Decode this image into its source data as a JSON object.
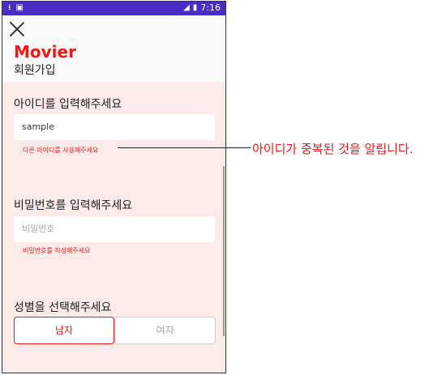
{
  "status_bar": {
    "time": "7:16",
    "left_icons": [
      "download-icon",
      "a-notification-icon"
    ],
    "right_icons": [
      "signal-icon",
      "battery-icon"
    ]
  },
  "header": {
    "brand": "Movier",
    "title": "회원가입"
  },
  "id_section": {
    "label": "아이디를 입력해주세요",
    "value": "sample",
    "error": "다른 아이디를 사용해주세요"
  },
  "password_section": {
    "label": "비밀번호를 입력해주세요",
    "placeholder": "비밀번호",
    "error": "비밀번호를 작성해주세요"
  },
  "gender_section": {
    "label": "성별을 선택해주세요",
    "options": [
      {
        "label": "남자",
        "selected": true
      },
      {
        "label": "여자",
        "selected": false
      }
    ]
  },
  "annotation": {
    "text": "아이디가 중복된 것을 알립니다."
  },
  "colors": {
    "accent": "#ee1a1a",
    "status_bar": "#4a2cc4",
    "content_bg": "#fdebea"
  }
}
